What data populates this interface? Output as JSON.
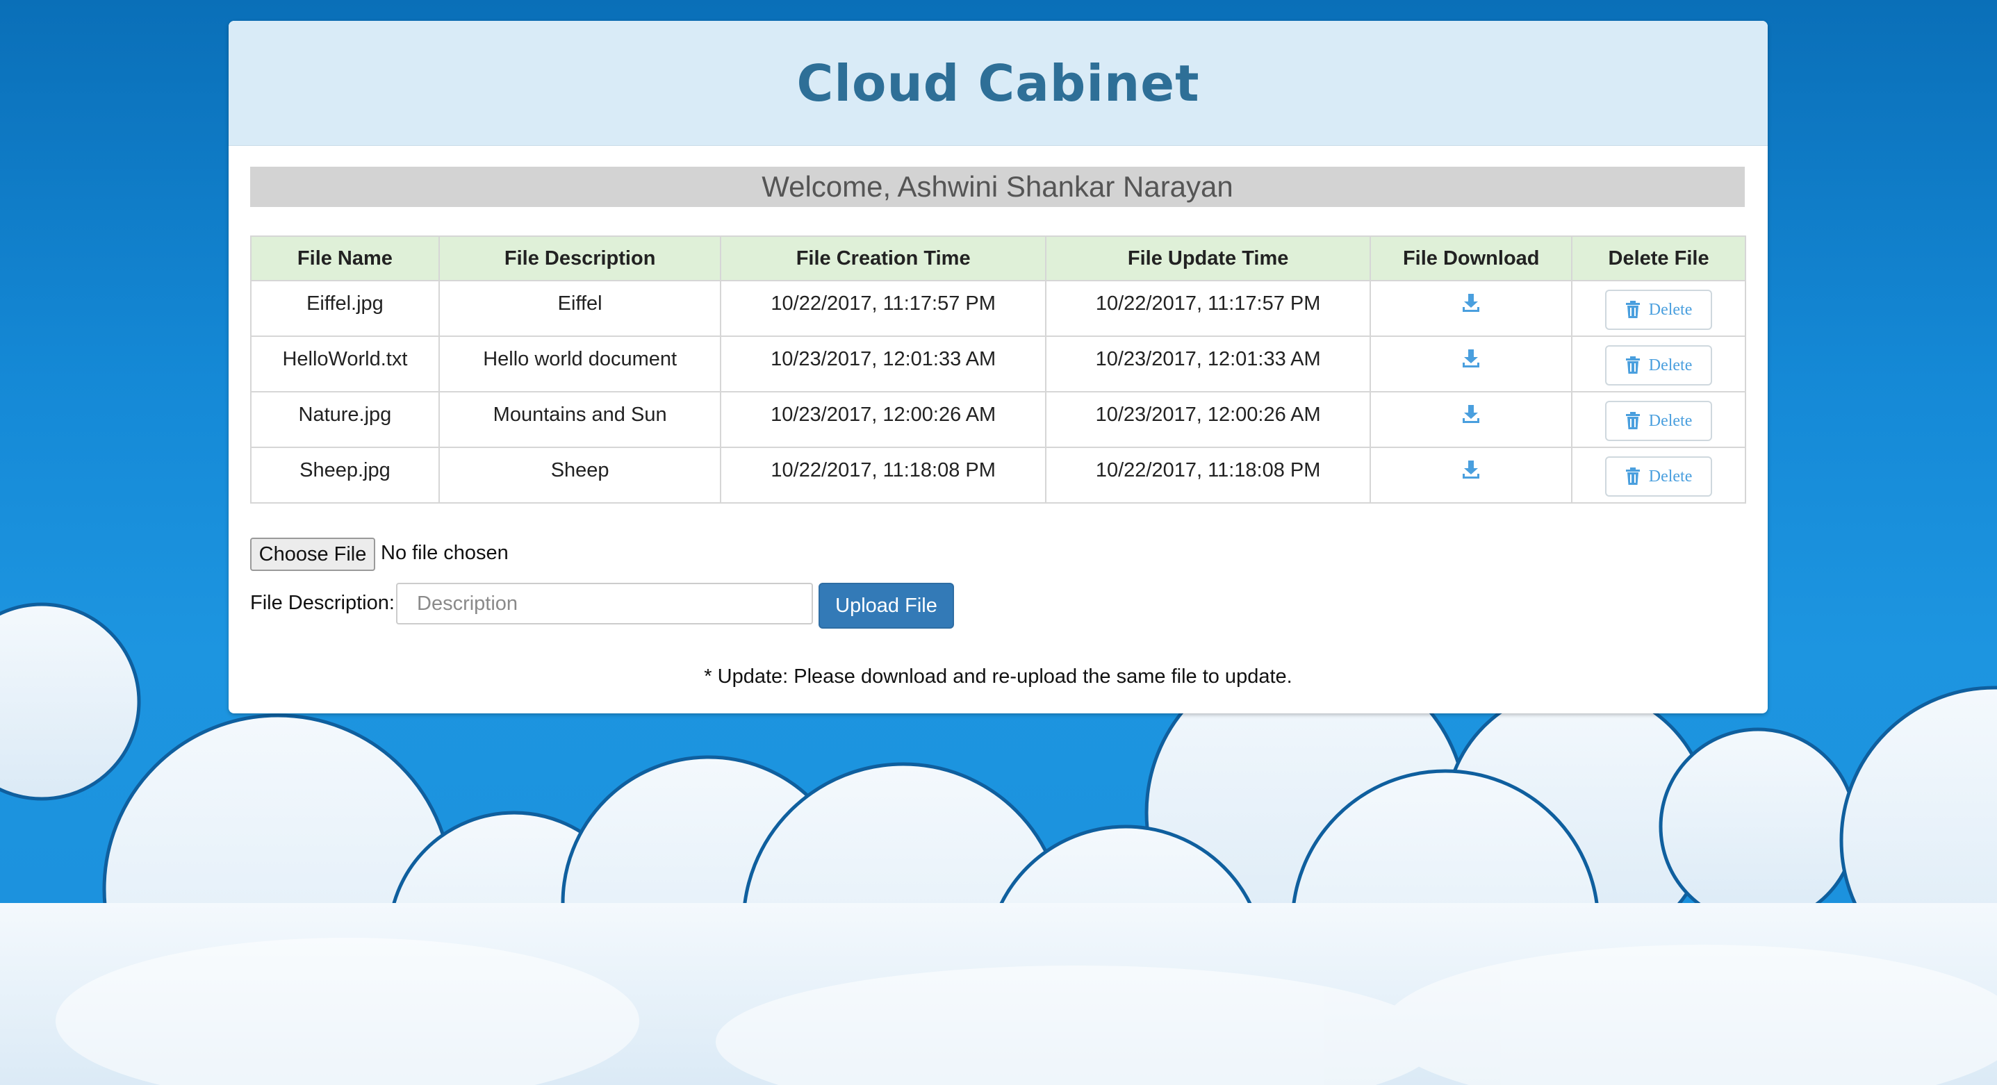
{
  "app": {
    "title": "Cloud Cabinet"
  },
  "welcome": "Welcome, Ashwini Shankar Narayan",
  "table": {
    "headers": [
      "File Name",
      "File Description",
      "File Creation Time",
      "File Update Time",
      "File Download",
      "Delete File"
    ],
    "rows": [
      {
        "name": "Eiffel.jpg",
        "description": "Eiffel",
        "created": "10/22/2017, 11:17:57 PM",
        "updated": "10/22/2017, 11:17:57 PM",
        "delete_label": "Delete"
      },
      {
        "name": "HelloWorld.txt",
        "description": "Hello world document",
        "created": "10/23/2017, 12:01:33 AM",
        "updated": "10/23/2017, 12:01:33 AM",
        "delete_label": "Delete"
      },
      {
        "name": "Nature.jpg",
        "description": "Mountains and Sun",
        "created": "10/23/2017, 12:00:26 AM",
        "updated": "10/23/2017, 12:00:26 AM",
        "delete_label": "Delete"
      },
      {
        "name": "Sheep.jpg",
        "description": "Sheep",
        "created": "10/22/2017, 11:18:08 PM",
        "updated": "10/22/2017, 11:18:08 PM",
        "delete_label": "Delete"
      }
    ]
  },
  "upload": {
    "choose_label": "Choose File",
    "no_file_text": "No file chosen",
    "description_label": "File Description:",
    "description_placeholder": "Description",
    "description_value": "",
    "button_label": "Upload File"
  },
  "note": "* Update: Please download and re-upload the same file to update.",
  "icons": {
    "download": "download-icon",
    "delete": "trash-icon"
  },
  "colors": {
    "title": "#2e6f97",
    "header_bg": "#d9ebf7",
    "table_header_bg": "#dff0d8",
    "accent": "#337ab7",
    "icon_blue": "#4a9fde",
    "welcome_bg": "#d3d3d3"
  }
}
